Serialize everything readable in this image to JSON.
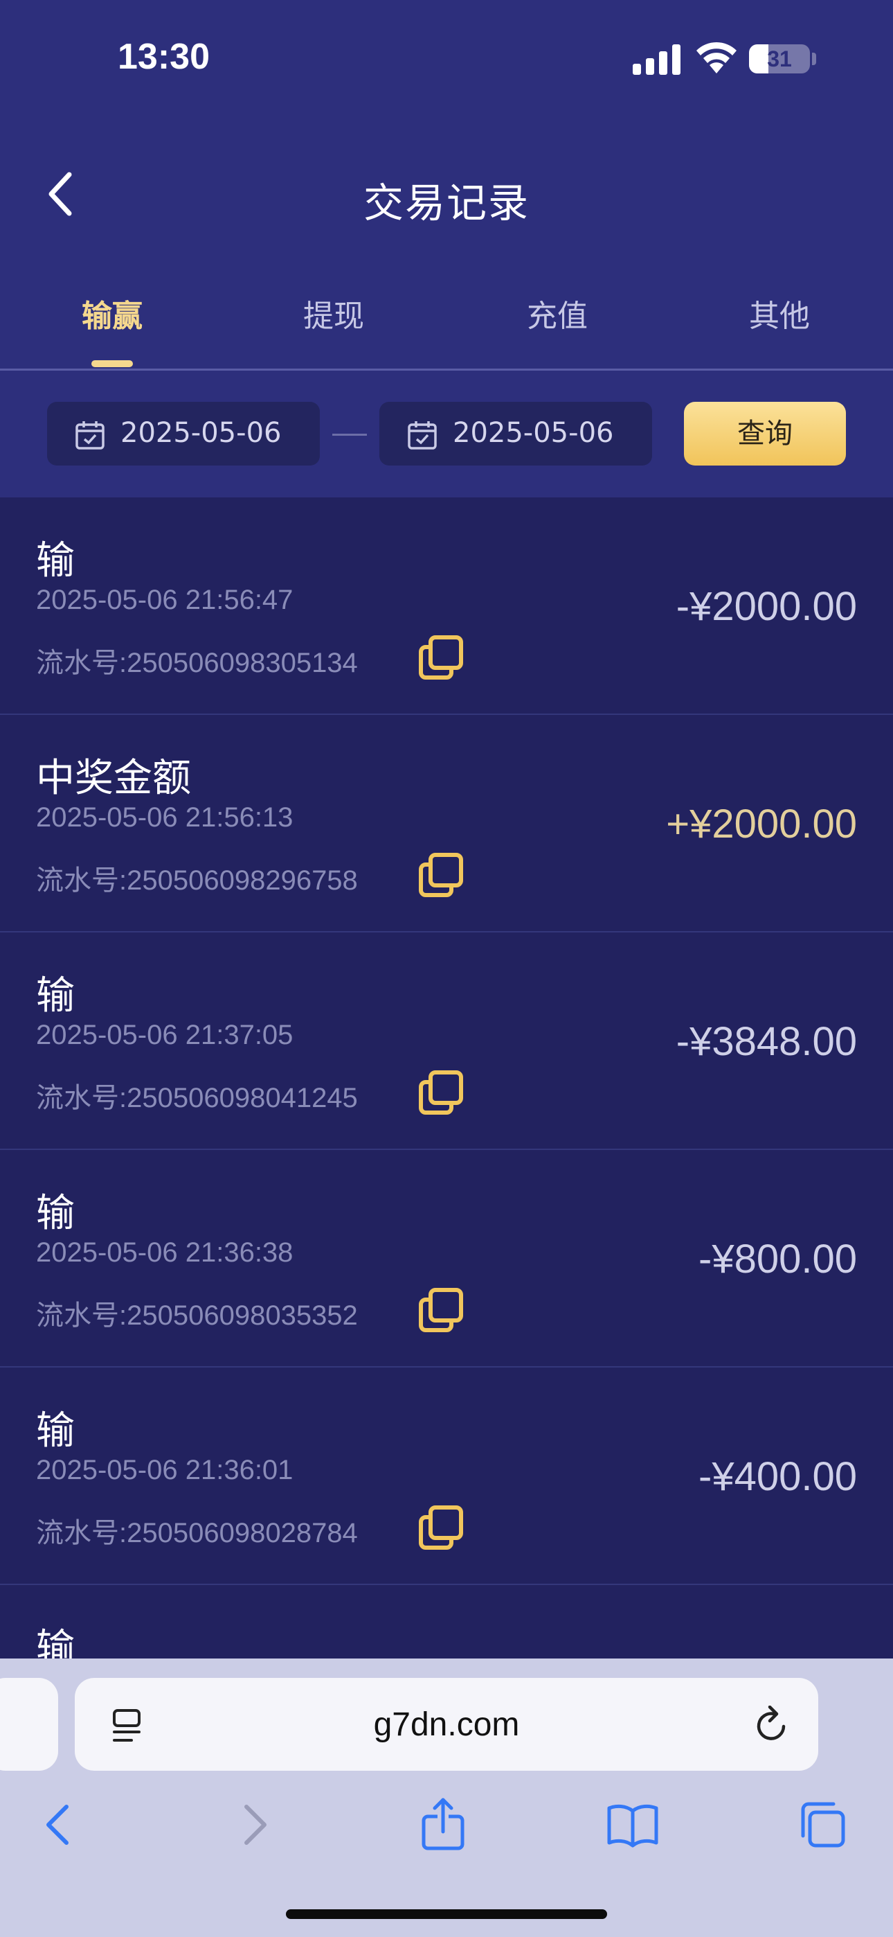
{
  "status_bar": {
    "time": "13:30",
    "battery": "31"
  },
  "header": {
    "title": "交易记录"
  },
  "tabs": [
    {
      "label": "输赢",
      "active": true
    },
    {
      "label": "提现",
      "active": false
    },
    {
      "label": "充值",
      "active": false
    },
    {
      "label": "其他",
      "active": false
    }
  ],
  "filter": {
    "start_date": "2025-05-06",
    "end_date": "2025-05-06",
    "query_label": "查询"
  },
  "records": [
    {
      "type": "输",
      "time": "2025-05-06 21:56:47",
      "serial": "流水号:250506098305134",
      "amount": "-¥2000.00"
    },
    {
      "type": "中奖金额",
      "time": "2025-05-06 21:56:13",
      "serial": "流水号:250506098296758",
      "amount": "+¥2000.00"
    },
    {
      "type": "输",
      "time": "2025-05-06 21:37:05",
      "serial": "流水号:250506098041245",
      "amount": "-¥3848.00"
    },
    {
      "type": "输",
      "time": "2025-05-06 21:36:38",
      "serial": "流水号:250506098035352",
      "amount": "-¥800.00"
    },
    {
      "type": "输",
      "time": "2025-05-06 21:36:01",
      "serial": "流水号:250506098028784",
      "amount": "-¥400.00"
    },
    {
      "type": "输"
    }
  ],
  "browser": {
    "url": "g7dn.com"
  },
  "colors": {
    "accent_gold": "#f5d88e",
    "positive_amount": "#e3cf9c",
    "link_blue": "#3478f6"
  }
}
